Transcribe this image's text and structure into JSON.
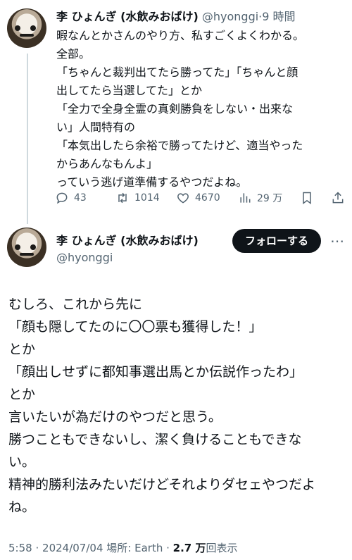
{
  "tweet1": {
    "author_name": "李 ひょんぎ (水飲みおばけ)",
    "handle": "@hyonggi",
    "separator": "·",
    "time": "9 時間",
    "lines": [
      "暇なんとかさんのやり方、私すごくよくわかる。",
      "全部。",
      "「ちゃんと裁判出てたら勝ってた」「ちゃんと顔",
      "出してたら当選してた」とか",
      "「全力で全身全霊の真剣勝負をしない・出来な",
      "い」人間特有の",
      "「本気出したら余裕で勝ってたけど、適当やった",
      "からあんなもんよ」",
      "っていう逃げ道準備するやつだよね。"
    ],
    "actions": {
      "reply_count": "43",
      "retweet_count": "1014",
      "like_count": "4670",
      "views_count": "29 万",
      "reply_icon": "reply-icon",
      "retweet_icon": "retweet-icon",
      "like_icon": "heart-icon",
      "views_icon": "views-icon",
      "bookmark_icon": "bookmark-icon",
      "share_icon": "share-icon"
    }
  },
  "tweet2": {
    "author_name": "李 ひょんぎ (水飲みおばけ)",
    "handle": "@hyonggi",
    "follow_label": "フォローする",
    "more_icon": "more-icon",
    "lines": [
      "むしろ、これから先に",
      "「顔も隠してたのに〇〇票も獲得した！」",
      "とか",
      "「顔出しせずに都知事選出馬とか伝説作ったわ」",
      "とか",
      "言いたいが為だけのやつだと思う。",
      "勝つこともできないし、潔く負けることもできな",
      "い。",
      "精神的勝利法みたいだけどそれよりダセェやつだよ",
      "ね。"
    ],
    "meta": {
      "time": "5:58",
      "sep1": "·",
      "date": "2024/07/04",
      "location": "場所: Earth",
      "sep2": "·",
      "views_value": "2.7 万",
      "views_label": "回表示"
    }
  },
  "colors": {
    "text": "#0f1419",
    "secondary": "#536471",
    "thread_line": "#cfd9de",
    "follow_button_bg": "#0f1419",
    "follow_button_text": "#ffffff"
  }
}
